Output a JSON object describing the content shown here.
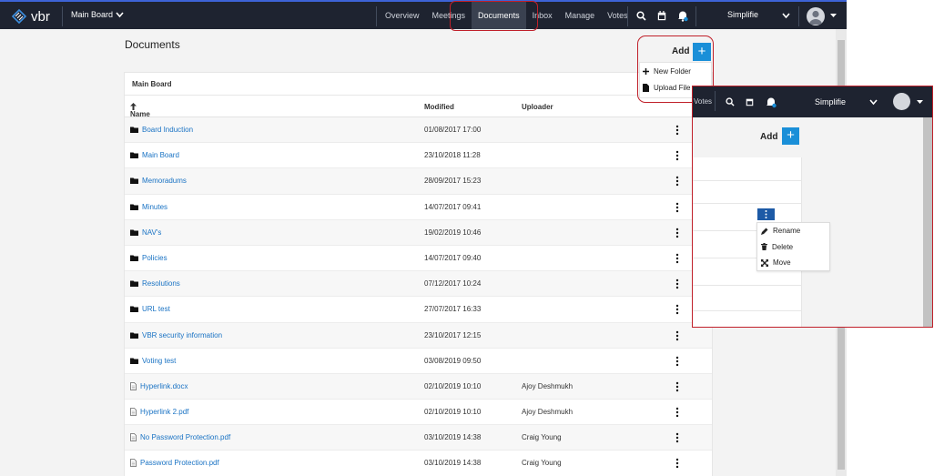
{
  "app": {
    "brand": "vbr",
    "board": "Main Board",
    "user": "Simplifie"
  },
  "nav": [
    "Overview",
    "Meetings",
    "Documents",
    "Inbox",
    "Manage",
    "Votes"
  ],
  "active_nav": "Documents",
  "page": {
    "title": "Documents",
    "add_label": "Add"
  },
  "add_menu": [
    "New Folder",
    "Upload File"
  ],
  "table": {
    "header": "Main Board",
    "columns": {
      "name": "Name",
      "modified": "Modified",
      "uploader": "Uploader"
    },
    "rows": [
      {
        "type": "folder",
        "name": "Board Induction",
        "modified": "01/08/2017 17:00",
        "uploader": ""
      },
      {
        "type": "folder",
        "name": "Main Board",
        "modified": "23/10/2018 11:28",
        "uploader": ""
      },
      {
        "type": "folder",
        "name": "Memoradums",
        "modified": "28/09/2017 15:23",
        "uploader": ""
      },
      {
        "type": "folder",
        "name": "Minutes",
        "modified": "14/07/2017 09:41",
        "uploader": ""
      },
      {
        "type": "folder",
        "name": "NAV's",
        "modified": "19/02/2019 10:46",
        "uploader": ""
      },
      {
        "type": "folder",
        "name": "Policies",
        "modified": "14/07/2017 09:40",
        "uploader": ""
      },
      {
        "type": "folder",
        "name": "Resolutions",
        "modified": "07/12/2017 10:24",
        "uploader": ""
      },
      {
        "type": "folder",
        "name": "URL test",
        "modified": "27/07/2017 16:33",
        "uploader": ""
      },
      {
        "type": "folder",
        "name": "VBR security information",
        "modified": "23/10/2017 12:15",
        "uploader": ""
      },
      {
        "type": "folder",
        "name": "Voting test",
        "modified": "03/08/2019 09:50",
        "uploader": ""
      },
      {
        "type": "file",
        "name": "Hyperlink.docx",
        "modified": "02/10/2019 10:10",
        "uploader": "Ajoy Deshmukh"
      },
      {
        "type": "file",
        "name": "Hyperlink 2.pdf",
        "modified": "02/10/2019 10:10",
        "uploader": "Ajoy Deshmukh"
      },
      {
        "type": "file",
        "name": "No Password Protection.pdf",
        "modified": "03/10/2019 14:38",
        "uploader": "Craig Young"
      },
      {
        "type": "file",
        "name": "Password Protection.pdf",
        "modified": "03/10/2019 14:38",
        "uploader": "Craig Young"
      }
    ]
  },
  "zoom": {
    "votes_label": "Votes",
    "user": "Simplifie",
    "add_label": "Add",
    "context_menu": [
      "Rename",
      "Delete",
      "Move"
    ]
  },
  "colors": {
    "topbar": "#1e2330",
    "accent": "#1a8fd8",
    "link": "#1a73c4",
    "highlight": "#c0202a"
  }
}
